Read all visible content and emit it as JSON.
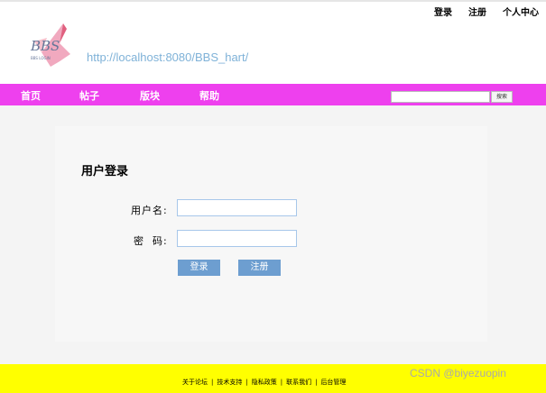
{
  "header": {
    "links": [
      "登录",
      "注册",
      "个人中心"
    ],
    "logo_text": "BBS",
    "logo_subtext": "BBS LOGIN",
    "site_url": "http://localhost:8080/BBS_hart/"
  },
  "nav": {
    "items": [
      "首页",
      "帖子",
      "版块",
      "帮助"
    ],
    "search_value": "",
    "search_button": "搜索",
    "color": "#ee40ee"
  },
  "login": {
    "title": "用户登录",
    "username_label": "用户名:",
    "password_label": "密  码:",
    "username_value": "",
    "password_value": "",
    "login_button": "登录",
    "register_button": "注册",
    "button_color": "#6d9ed0"
  },
  "footer": {
    "links": [
      "关于论坛",
      "技术支持",
      "隐私政策",
      "联系我们",
      "后台管理"
    ],
    "color": "#ffff00"
  },
  "watermark": "CSDN @biyezuopin"
}
